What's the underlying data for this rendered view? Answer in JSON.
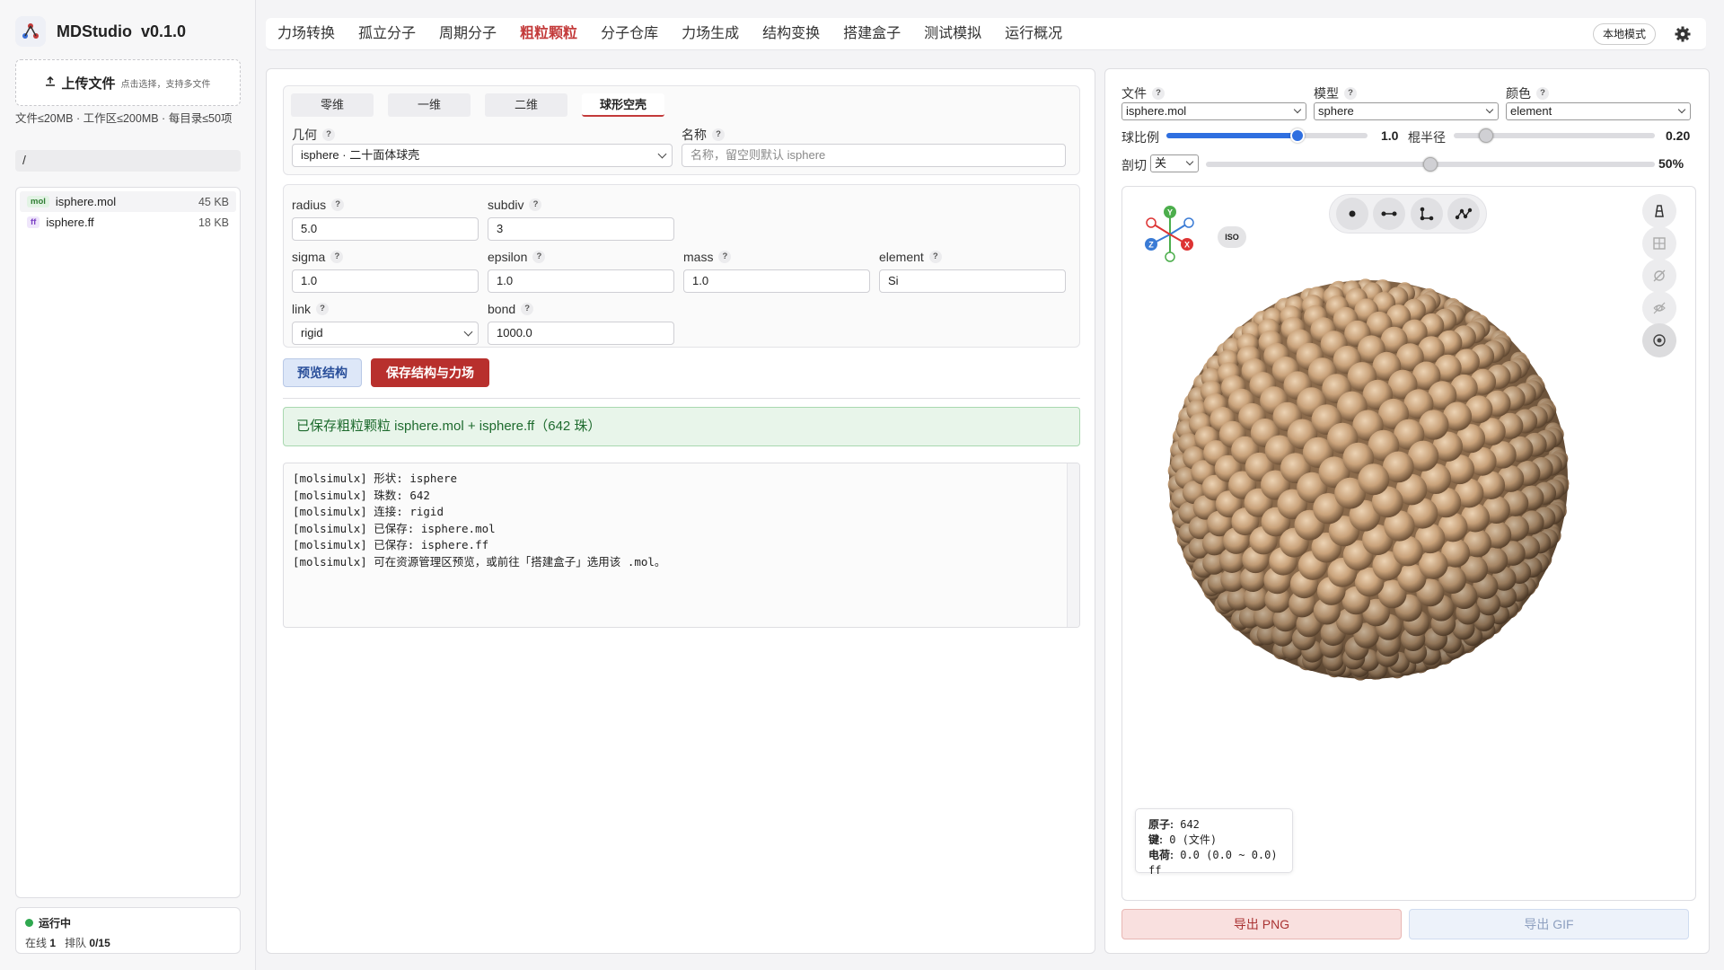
{
  "app": {
    "name": "MDStudio",
    "version": "v0.1.0"
  },
  "sidebar": {
    "upload_label": "上传文件",
    "upload_hint": "点击选择，支持多文件",
    "limits": "文件≤20MB · 工作区≤200MB · 每目录≤50项",
    "path": "/",
    "files": [
      {
        "badge": "mol",
        "name": "isphere.mol",
        "size": "45 KB"
      },
      {
        "badge": "ff",
        "name": "isphere.ff",
        "size": "18 KB"
      }
    ],
    "status": {
      "state": "运行中",
      "online_label": "在线",
      "online_value": "1",
      "queue_label": "排队",
      "queue_value": "0/15"
    }
  },
  "nav": {
    "tabs": [
      "力场转换",
      "孤立分子",
      "周期分子",
      "粗粒颗粒",
      "分子仓库",
      "力场生成",
      "结构变换",
      "搭建盒子",
      "测试模拟",
      "运行概况"
    ],
    "active_tab": "粗粒颗粒",
    "mode_label": "本地模式"
  },
  "form": {
    "subtabs": [
      "零维",
      "一维",
      "二维",
      "球形空壳"
    ],
    "active_subtab": "球形空壳",
    "geometry_label": "几何",
    "geometry_value": "isphere · 二十面体球壳",
    "name_label": "名称",
    "name_placeholder": "名称，留空则默认 isphere",
    "params": {
      "radius": {
        "label": "radius",
        "value": "5.0"
      },
      "subdiv": {
        "label": "subdiv",
        "value": "3"
      },
      "sigma": {
        "label": "sigma",
        "value": "1.0"
      },
      "epsilon": {
        "label": "epsilon",
        "value": "1.0"
      },
      "mass": {
        "label": "mass",
        "value": "1.0"
      },
      "element": {
        "label": "element",
        "value": "Si"
      },
      "link": {
        "label": "link",
        "value": "rigid"
      },
      "bond": {
        "label": "bond",
        "value": "1000.0"
      }
    },
    "preview_button": "预览结构",
    "save_button": "保存结构与力场",
    "success_message": "已保存粗粒颗粒 isphere.mol + isphere.ff（642 珠）",
    "console": "[molsimulx] 形状: isphere\n[molsimulx] 珠数: 642\n[molsimulx] 连接: rigid\n[molsimulx] 已保存: isphere.mol\n[molsimulx] 已保存: isphere.ff\n[molsimulx] 可在资源管理区预览，或前往「搭建盒子」选用该 .mol。"
  },
  "viewer": {
    "file_label": "文件",
    "file_value": "isphere.mol",
    "model_label": "模型",
    "model_value": "sphere",
    "color_label": "颜色",
    "color_value": "element",
    "ball_scale_label": "球比例",
    "ball_scale_value": "1.0",
    "ball_scale_fraction": 0.65,
    "stick_radius_label": "棍半径",
    "stick_radius_value": "0.20",
    "stick_radius_fraction": 0.16,
    "clip_label": "剖切",
    "clip_select": "关",
    "clip_value": "50%",
    "clip_fraction": 0.5,
    "iso_label": "ISO",
    "axes": {
      "x": "X",
      "y": "Y",
      "z": "Z"
    },
    "info": {
      "atoms_label": "原子:",
      "atoms_value": "642",
      "bonds_label": "键:",
      "bonds_value": "0 (文件)",
      "charge_label": "电荷:",
      "charge_value": "0.0 (0.0 ~ 0.0) ff"
    },
    "export_png": "导出 PNG",
    "export_gif": "导出 GIF",
    "bead_color": "#c9a27a"
  }
}
